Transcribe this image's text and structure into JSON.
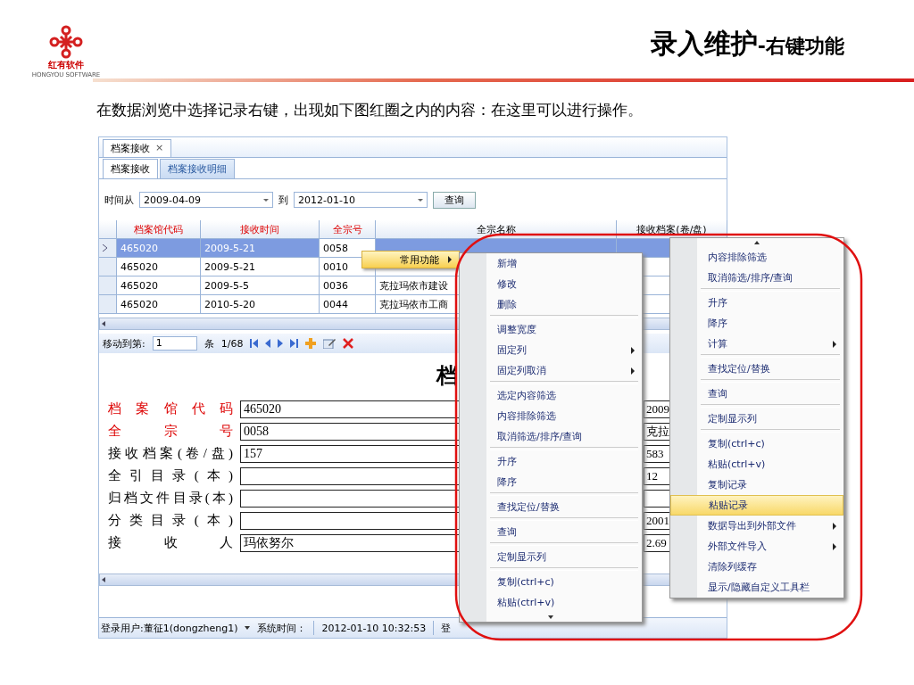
{
  "slide": {
    "logo_name": "红有软件",
    "logo_subtitle": "HONGYOU SOFTWARE",
    "title": "录入维护",
    "title_suffix": "-右键功能",
    "intro": "在数据浏览中选择记录右键，出现如下图红圈之内的内容：在这里可以进行操作。"
  },
  "window": {
    "doc_tab": {
      "label": "档案接收",
      "close": "×"
    },
    "tabs": [
      {
        "label": "档案接收",
        "selected": true
      },
      {
        "label": "档案接收明细",
        "selected": false
      }
    ],
    "filter": {
      "from_label": "时间从",
      "from": "2009-04-09",
      "to_label": "到",
      "to": "2012-01-10",
      "button": "查询"
    },
    "table": {
      "columns": [
        {
          "label": "档案馆代码",
          "required": true
        },
        {
          "label": "接收时间",
          "required": true
        },
        {
          "label": "全宗号",
          "required": true
        },
        {
          "label": "全宗名称",
          "required": false
        },
        {
          "label": "接收档案(卷/盘)",
          "required": false
        }
      ],
      "rows": [
        {
          "selected": true,
          "cells": [
            "465020",
            "2009-5-21",
            "0058"
          ]
        },
        {
          "selected": false,
          "cells": [
            "465020",
            "2009-5-21",
            "0010"
          ]
        },
        {
          "selected": false,
          "cells": [
            "465020",
            "2009-5-5",
            "0036",
            "克拉玛依市建设"
          ]
        },
        {
          "selected": false,
          "cells": [
            "465020",
            "2010-5-20",
            "0044",
            "克拉玛依市工商"
          ]
        }
      ]
    },
    "pager": {
      "label": "移动到第:",
      "page": "1",
      "unit": "条",
      "position": "1/68"
    },
    "form": {
      "title": "档",
      "fields": [
        {
          "label": "档案馆代码",
          "required": true,
          "value": "465020",
          "value_2": "2009"
        },
        {
          "label": "全宗号",
          "required": true,
          "value": "0058",
          "value_2": "克拉"
        },
        {
          "label": "接收档案(卷/盘)",
          "required": false,
          "value": "157",
          "value_2": "583"
        },
        {
          "label": "全引目录(本)",
          "required": false,
          "value_2": "12"
        },
        {
          "label": "归档文件目录(本)",
          "required": false
        },
        {
          "label": "分类目录(本)",
          "required": false,
          "value_2": "2001"
        },
        {
          "label": "接收人",
          "required": false,
          "value": "玛依努尔",
          "value_2": "2.69"
        }
      ]
    },
    "status_bar": {
      "user": "登录用户:董征1(dongzheng1)",
      "time_label": "系统时间：",
      "time": "2012-01-10 10:32:53",
      "login": "登"
    }
  },
  "trigger": {
    "label": "常用功能"
  },
  "menus": [
    {
      "groups": [
        [
          {
            "label": "新增",
            "submenu": false,
            "selected": false
          },
          {
            "label": "修改",
            "submenu": false,
            "selected": false
          },
          {
            "label": "删除",
            "submenu": false,
            "selected": false
          }
        ],
        [
          {
            "label": "调整宽度",
            "submenu": false,
            "selected": false
          },
          {
            "label": "固定列",
            "submenu": true,
            "selected": false
          },
          {
            "label": "固定列取消",
            "submenu": true,
            "selected": false
          }
        ],
        [
          {
            "label": "选定内容筛选",
            "submenu": false,
            "selected": false
          },
          {
            "label": "内容排除筛选",
            "submenu": false,
            "selected": false
          },
          {
            "label": "取消筛选/排序/查询",
            "submenu": false,
            "selected": false
          }
        ],
        [
          {
            "label": "升序",
            "submenu": false,
            "selected": false
          },
          {
            "label": "降序",
            "submenu": false,
            "selected": false
          }
        ],
        [
          {
            "label": "查找定位/替换",
            "submenu": false,
            "selected": false
          }
        ],
        [
          {
            "label": "查询",
            "submenu": false,
            "selected": false
          }
        ],
        [
          {
            "label": "定制显示列",
            "submenu": false,
            "selected": false
          }
        ],
        [
          {
            "label": "复制(ctrl+c)",
            "submenu": false,
            "selected": false
          },
          {
            "label": "粘贴(ctrl+v)",
            "submenu": false,
            "selected": false
          }
        ]
      ]
    },
    {
      "groups": [
        [
          {
            "label": "内容排除筛选",
            "submenu": false,
            "selected": false
          },
          {
            "label": "取消筛选/排序/查询",
            "submenu": false,
            "selected": false
          }
        ],
        [
          {
            "label": "升序",
            "submenu": false,
            "selected": false
          },
          {
            "label": "降序",
            "submenu": false,
            "selected": false
          },
          {
            "label": "计算",
            "submenu": true,
            "selected": false
          }
        ],
        [
          {
            "label": "查找定位/替换",
            "submenu": false,
            "selected": false
          }
        ],
        [
          {
            "label": "查询",
            "submenu": false,
            "selected": false
          }
        ],
        [
          {
            "label": "定制显示列",
            "submenu": false,
            "selected": false
          }
        ],
        [
          {
            "label": "复制(ctrl+c)",
            "submenu": false,
            "selected": false
          },
          {
            "label": "粘贴(ctrl+v)",
            "submenu": false,
            "selected": false
          },
          {
            "label": "复制记录",
            "submenu": false,
            "selected": false
          },
          {
            "label": "粘贴记录",
            "submenu": false,
            "selected": true
          },
          {
            "label": "数据导出到外部文件",
            "submenu": true,
            "selected": false
          },
          {
            "label": "外部文件导入",
            "submenu": true,
            "selected": false
          },
          {
            "label": "清除列缓存",
            "submenu": false,
            "selected": false
          },
          {
            "label": "显示/隐藏自定义工具栏",
            "submenu": false,
            "selected": false
          }
        ]
      ]
    }
  ]
}
